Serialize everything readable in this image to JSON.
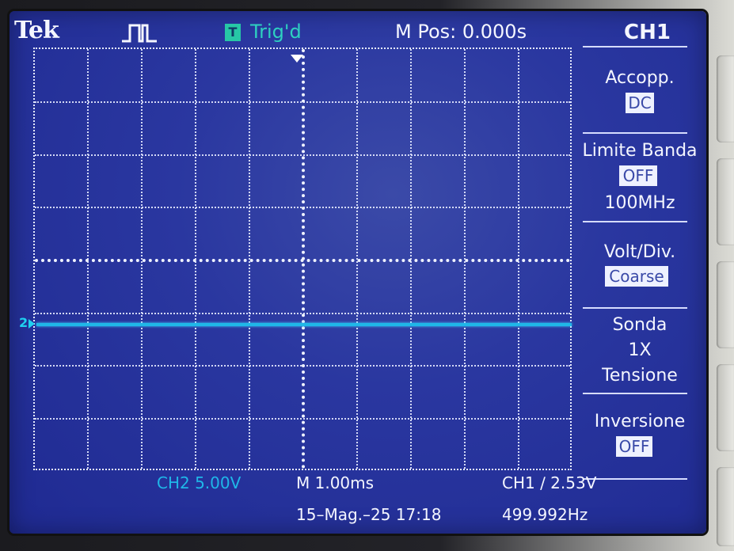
{
  "header": {
    "brand": "Tek",
    "acquisition_icon": "pulse-waveform-icon",
    "trigger_badge": "T",
    "trigger_status": "Trig'd",
    "main_position": "M Pos: 0.000s",
    "active_channel": "CH1"
  },
  "menu": {
    "coupling": {
      "title": "Accopp.",
      "value": "DC"
    },
    "bandwidth_limit": {
      "title": "Limite Banda",
      "value": "OFF",
      "sub": "100MHz"
    },
    "volts_per_div": {
      "title": "Volt/Div.",
      "value": "Coarse"
    },
    "probe": {
      "title": "Sonda",
      "value": "1X",
      "sub": "Tensione"
    },
    "invert": {
      "title": "Inversione",
      "value": "OFF"
    }
  },
  "trace": {
    "channel_marker": "2",
    "color": "#1fb7e8"
  },
  "status": {
    "ch2_scale": "CH2  5.00V",
    "timebase": "M 1.00ms",
    "trigger": "CH1 ∕ 2.53V",
    "datetime": "15–Mag.–25 17:18",
    "frequency": "499.992Hz"
  },
  "colors": {
    "screen_bg": "#2a37a0",
    "trace": "#1fb7e8",
    "trig_status": "#2ed0c0",
    "text": "#f4f6ff"
  }
}
